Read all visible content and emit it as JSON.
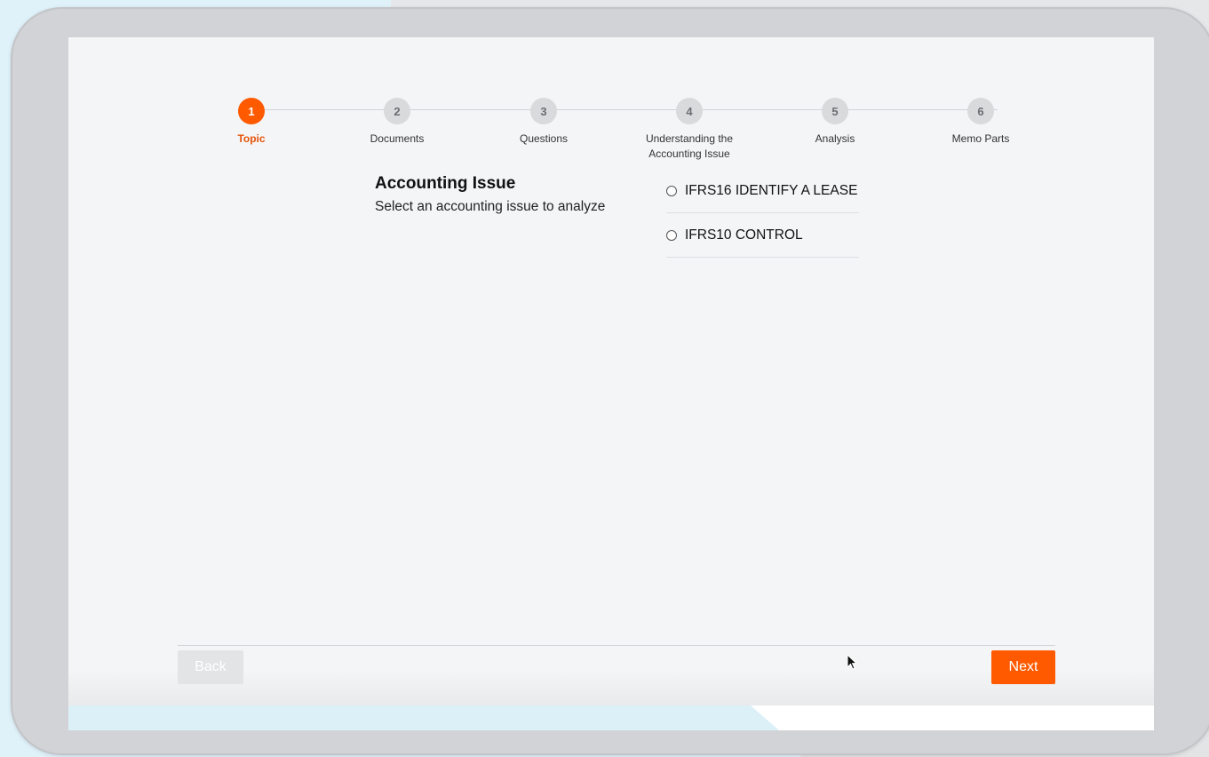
{
  "stepper": {
    "steps": [
      {
        "number": "1",
        "label": "Topic",
        "active": true
      },
      {
        "number": "2",
        "label": "Documents",
        "active": false
      },
      {
        "number": "3",
        "label": "Questions",
        "active": false
      },
      {
        "number": "4",
        "label_line1": "Understanding the",
        "label_line2": "Accounting Issue",
        "active": false
      },
      {
        "number": "5",
        "label": "Analysis",
        "active": false
      },
      {
        "number": "6",
        "label": "Memo Parts",
        "active": false
      }
    ]
  },
  "main": {
    "heading": "Accounting Issue",
    "subheading": "Select an accounting issue to analyze",
    "options": [
      {
        "label": "IFRS16 IDENTIFY A LEASE",
        "selected": false
      },
      {
        "label": "IFRS10 CONTROL",
        "selected": false
      }
    ]
  },
  "footer": {
    "back_label": "Back",
    "next_label": "Next",
    "back_enabled": false
  },
  "colors": {
    "accent": "#ff5a00",
    "inactive_step": "#d9dadc",
    "screen_bg": "#f4f5f7"
  }
}
